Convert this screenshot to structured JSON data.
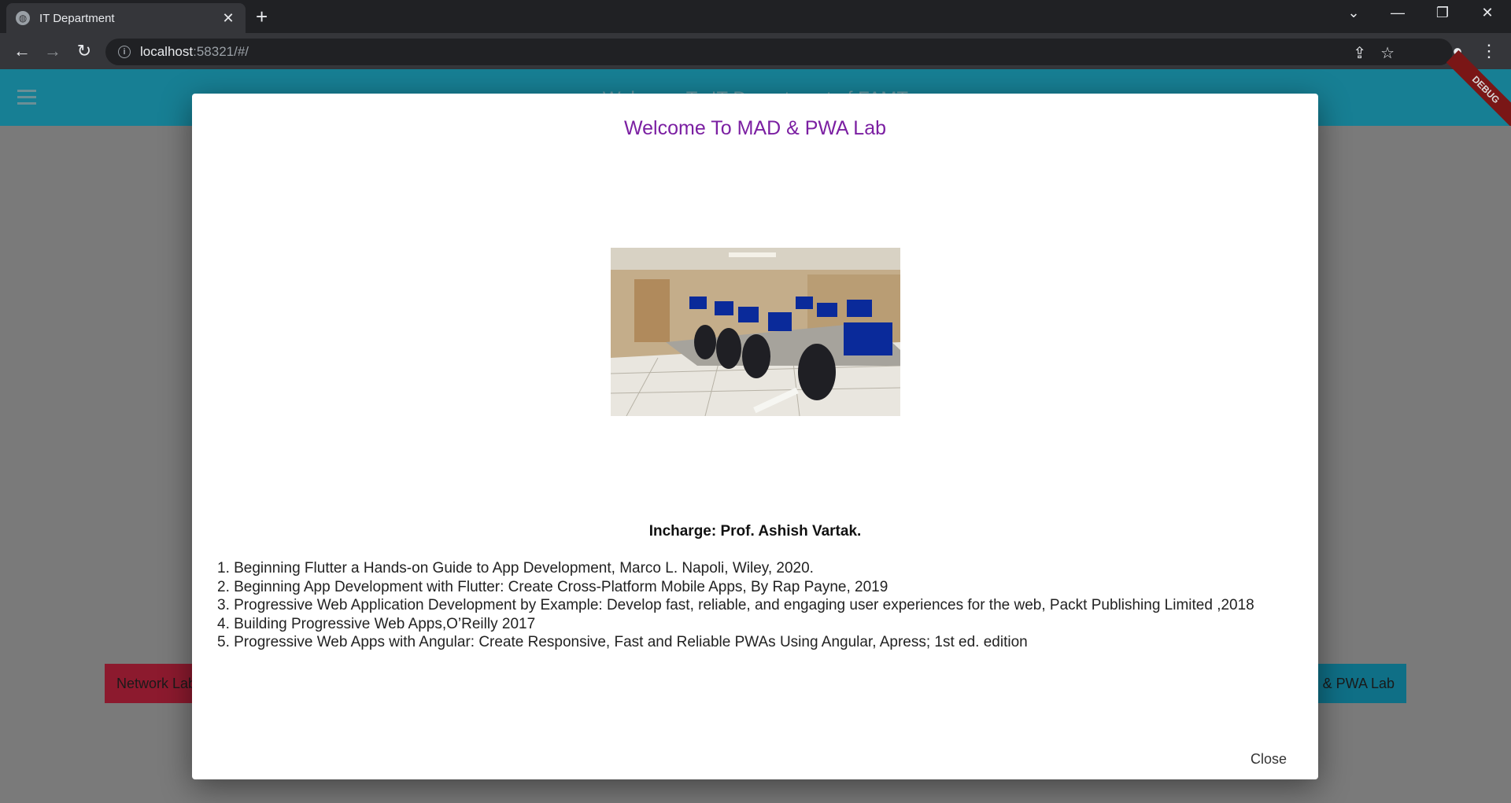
{
  "browser": {
    "tab_title": "IT Department",
    "url_host": "localhost",
    "url_rest": ":58321/#/"
  },
  "app": {
    "title": "Welcome To IT Department of FAMT",
    "debug_label": "DEBUG",
    "lab_buttons": {
      "network": "Network Lab",
      "mad": "MAD & PWA Lab"
    },
    "colors": {
      "app_bar": "#177f94",
      "network_button": "#8c1a2e",
      "mad_button": "#0f6f86"
    }
  },
  "dialog": {
    "title": "Welcome To MAD & PWA Lab",
    "image_description": "Computer lab photo",
    "incharge": "Incharge: Prof. Ashish Vartak.",
    "books": [
      " 1. Beginning Flutter a Hands-on Guide to App Development, Marco L. Napoli, Wiley, 2020.",
      "2. Beginning App Development with Flutter: Create Cross-Platform Mobile Apps, By Rap Payne, 2019",
      "3. Progressive Web Application Development by Example: Develop fast, reliable, and engaging user experiences for the web, Packt Publishing Limited ,2018",
      "4. Building Progressive Web Apps,O’Reilly 2017",
      "5. Progressive Web Apps with Angular: Create Responsive, Fast and Reliable PWAs Using Angular, Apress; 1st ed. edition"
    ],
    "close_label": "Close",
    "title_color": "#7b1fa2"
  }
}
